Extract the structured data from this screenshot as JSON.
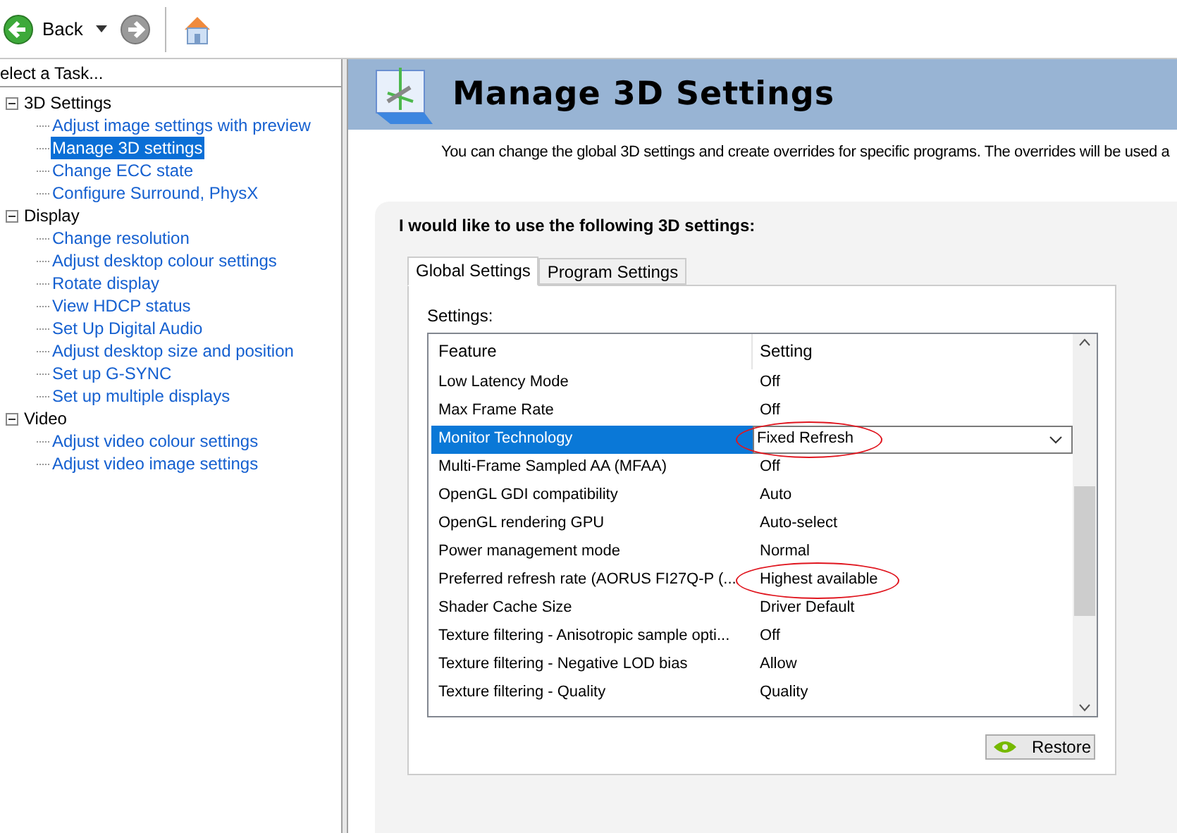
{
  "toolbar": {
    "back_label": "Back"
  },
  "task_pane": {
    "title": "elect a Task...",
    "tree": [
      {
        "label": "3D Settings",
        "expanded": true,
        "children": [
          {
            "label": "Adjust image settings with preview",
            "selected": false
          },
          {
            "label": "Manage 3D settings",
            "selected": true
          },
          {
            "label": "Change ECC state",
            "selected": false
          },
          {
            "label": "Configure Surround, PhysX",
            "selected": false
          }
        ]
      },
      {
        "label": "Display",
        "expanded": true,
        "children": [
          {
            "label": "Change resolution",
            "selected": false
          },
          {
            "label": "Adjust desktop colour settings",
            "selected": false
          },
          {
            "label": "Rotate display",
            "selected": false
          },
          {
            "label": "View HDCP status",
            "selected": false
          },
          {
            "label": "Set Up Digital Audio",
            "selected": false
          },
          {
            "label": "Adjust desktop size and position",
            "selected": false
          },
          {
            "label": "Set up G-SYNC",
            "selected": false
          },
          {
            "label": "Set up multiple displays",
            "selected": false
          }
        ]
      },
      {
        "label": "Video",
        "expanded": true,
        "children": [
          {
            "label": "Adjust video colour settings",
            "selected": false
          },
          {
            "label": "Adjust video image settings",
            "selected": false
          }
        ]
      }
    ]
  },
  "page": {
    "title": "Manage 3D Settings",
    "description": "You can change the global 3D settings and create overrides for specific programs. The overrides will be used a",
    "prompt": "I would like to use the following 3D settings:",
    "tabs": [
      {
        "label": "Global Settings",
        "selected": true
      },
      {
        "label": "Program Settings",
        "selected": false
      }
    ],
    "settings_label": "Settings:",
    "table": {
      "columns": [
        "Feature",
        "Setting"
      ],
      "rows": [
        {
          "feature": "Low Latency Mode",
          "setting": "Off",
          "selected": false,
          "circled": false
        },
        {
          "feature": "Max Frame Rate",
          "setting": "Off",
          "selected": false,
          "circled": false
        },
        {
          "feature": "Monitor Technology",
          "setting": "Fixed Refresh",
          "selected": true,
          "circled": true
        },
        {
          "feature": "Multi-Frame Sampled AA (MFAA)",
          "setting": "Off",
          "selected": false,
          "circled": false
        },
        {
          "feature": "OpenGL GDI compatibility",
          "setting": "Auto",
          "selected": false,
          "circled": false
        },
        {
          "feature": "OpenGL rendering GPU",
          "setting": "Auto-select",
          "selected": false,
          "circled": false
        },
        {
          "feature": "Power management mode",
          "setting": "Normal",
          "selected": false,
          "circled": false
        },
        {
          "feature": "Preferred refresh rate (AORUS FI27Q-P (...",
          "setting": "Highest available",
          "selected": false,
          "circled": true
        },
        {
          "feature": "Shader Cache Size",
          "setting": "Driver Default",
          "selected": false,
          "circled": false
        },
        {
          "feature": "Texture filtering - Anisotropic sample opti...",
          "setting": "Off",
          "selected": false,
          "circled": false
        },
        {
          "feature": "Texture filtering - Negative LOD bias",
          "setting": "Allow",
          "selected": false,
          "circled": false
        },
        {
          "feature": "Texture filtering - Quality",
          "setting": "Quality",
          "selected": false,
          "circled": false
        }
      ]
    },
    "restore_button": "Restore"
  }
}
